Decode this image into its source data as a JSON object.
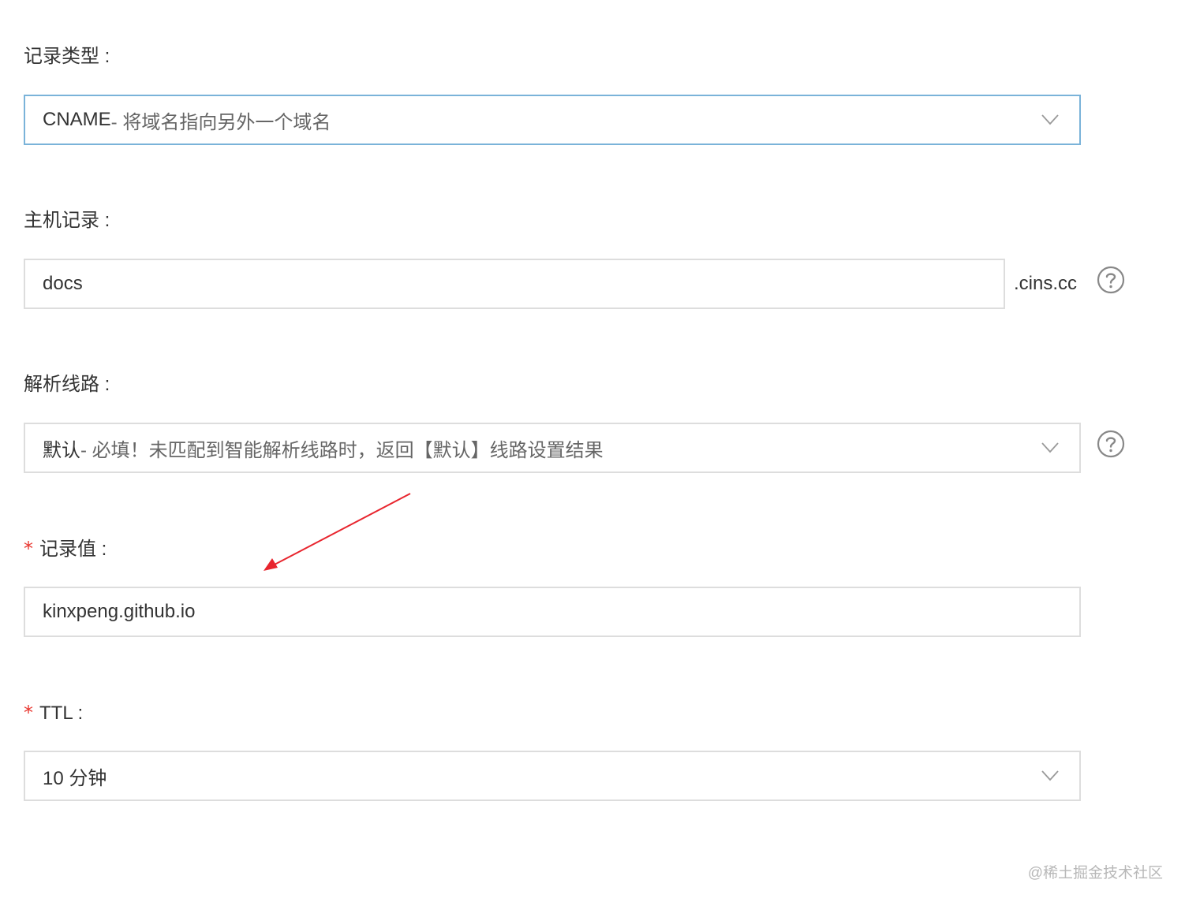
{
  "record_type": {
    "label": "记录类型 :",
    "value_main": "CNAME",
    "value_desc": "- 将域名指向另外一个域名"
  },
  "host_record": {
    "label": "主机记录 :",
    "value": "docs",
    "suffix": ".cins.cc"
  },
  "resolution_line": {
    "label": "解析线路 :",
    "value_main": "默认",
    "value_desc": " - 必填！未匹配到智能解析线路时，返回【默认】线路设置结果"
  },
  "record_value": {
    "required_mark": "*",
    "label": "记录值 :",
    "value": "kinxpeng.github.io"
  },
  "ttl": {
    "required_mark": "*",
    "label": "TTL :",
    "value": "10 分钟"
  },
  "watermark": "@稀土掘金技术社区",
  "icons": {
    "dropdown": "chevron-down-icon",
    "help": "question-circle-icon",
    "annotation": "red-arrow"
  },
  "colors": {
    "focus_border": "#7ab3d9",
    "required": "#e8352e",
    "arrow": "#e8252e"
  }
}
